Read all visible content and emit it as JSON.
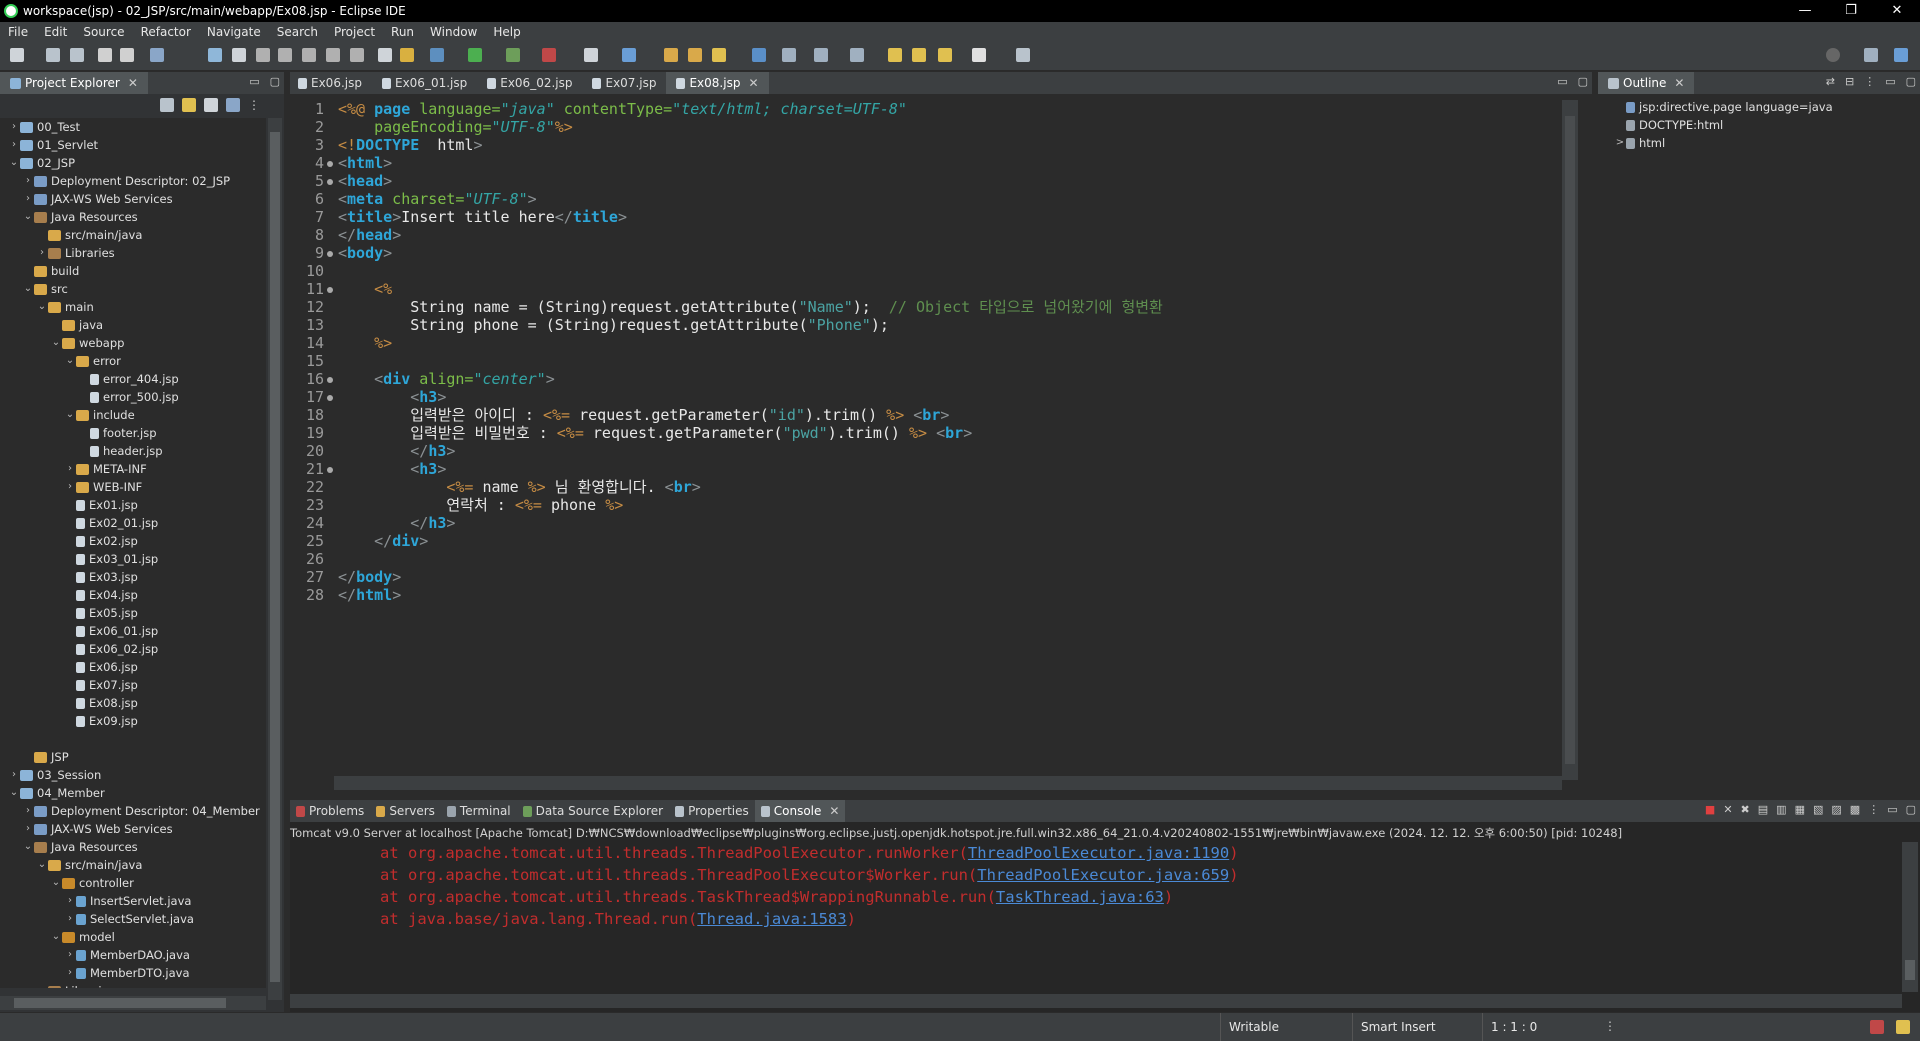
{
  "window": {
    "title": "workspace(jsp) - 02_JSP/src/main/webapp/Ex08.jsp - Eclipse IDE",
    "controls": [
      "—",
      "❐",
      "✕"
    ]
  },
  "menu": [
    "File",
    "Edit",
    "Source",
    "Refactor",
    "Navigate",
    "Search",
    "Project",
    "Run",
    "Window",
    "Help"
  ],
  "project_explorer": {
    "title": "Project Explorer",
    "items": [
      {
        "label": "00_Test",
        "indent": 0,
        "arrow": ">",
        "icon": "proj"
      },
      {
        "label": "01_Servlet",
        "indent": 0,
        "arrow": ">",
        "icon": "proj"
      },
      {
        "label": "02_JSP",
        "indent": 0,
        "arrow": "v",
        "icon": "proj"
      },
      {
        "label": "Deployment Descriptor: 02_JSP",
        "indent": 1,
        "arrow": ">",
        "icon": "svc"
      },
      {
        "label": "JAX-WS Web Services",
        "indent": 1,
        "arrow": ">",
        "icon": "svc"
      },
      {
        "label": "Java Resources",
        "indent": 1,
        "arrow": "v",
        "icon": "lib"
      },
      {
        "label": "src/main/java",
        "indent": 2,
        "arrow": "",
        "icon": "folder"
      },
      {
        "label": "Libraries",
        "indent": 2,
        "arrow": ">",
        "icon": "lib"
      },
      {
        "label": "build",
        "indent": 1,
        "arrow": "",
        "icon": "folder"
      },
      {
        "label": "src",
        "indent": 1,
        "arrow": "v",
        "icon": "folder"
      },
      {
        "label": "main",
        "indent": 2,
        "arrow": "v",
        "icon": "folder"
      },
      {
        "label": "java",
        "indent": 3,
        "arrow": "",
        "icon": "folder"
      },
      {
        "label": "webapp",
        "indent": 3,
        "arrow": "v",
        "icon": "folder"
      },
      {
        "label": "error",
        "indent": 4,
        "arrow": "v",
        "icon": "folder"
      },
      {
        "label": "error_404.jsp",
        "indent": 5,
        "arrow": "",
        "icon": "file"
      },
      {
        "label": "error_500.jsp",
        "indent": 5,
        "arrow": "",
        "icon": "file"
      },
      {
        "label": "include",
        "indent": 4,
        "arrow": "v",
        "icon": "folder"
      },
      {
        "label": "footer.jsp",
        "indent": 5,
        "arrow": "",
        "icon": "file"
      },
      {
        "label": "header.jsp",
        "indent": 5,
        "arrow": "",
        "icon": "file"
      },
      {
        "label": "META-INF",
        "indent": 4,
        "arrow": ">",
        "icon": "folder"
      },
      {
        "label": "WEB-INF",
        "indent": 4,
        "arrow": ">",
        "icon": "folder"
      },
      {
        "label": "Ex01.jsp",
        "indent": 4,
        "arrow": "",
        "icon": "file"
      },
      {
        "label": "Ex02_01.jsp",
        "indent": 4,
        "arrow": "",
        "icon": "file"
      },
      {
        "label": "Ex02.jsp",
        "indent": 4,
        "arrow": "",
        "icon": "file"
      },
      {
        "label": "Ex03_01.jsp",
        "indent": 4,
        "arrow": "",
        "icon": "file"
      },
      {
        "label": "Ex03.jsp",
        "indent": 4,
        "arrow": "",
        "icon": "file"
      },
      {
        "label": "Ex04.jsp",
        "indent": 4,
        "arrow": "",
        "icon": "file"
      },
      {
        "label": "Ex05.jsp",
        "indent": 4,
        "arrow": "",
        "icon": "file"
      },
      {
        "label": "Ex06_01.jsp",
        "indent": 4,
        "arrow": "",
        "icon": "file"
      },
      {
        "label": "Ex06_02.jsp",
        "indent": 4,
        "arrow": "",
        "icon": "file"
      },
      {
        "label": "Ex06.jsp",
        "indent": 4,
        "arrow": "",
        "icon": "file"
      },
      {
        "label": "Ex07.jsp",
        "indent": 4,
        "arrow": "",
        "icon": "file"
      },
      {
        "label": "Ex08.jsp",
        "indent": 4,
        "arrow": "",
        "icon": "file"
      },
      {
        "label": "Ex09.jsp",
        "indent": 4,
        "arrow": "",
        "icon": "file"
      },
      {
        "label": "",
        "indent": 0,
        "arrow": "",
        "icon": ""
      },
      {
        "label": "JSP",
        "indent": 1,
        "arrow": "",
        "icon": "folder"
      },
      {
        "label": "03_Session",
        "indent": 0,
        "arrow": ">",
        "icon": "proj"
      },
      {
        "label": "04_Member",
        "indent": 0,
        "arrow": "v",
        "icon": "proj"
      },
      {
        "label": "Deployment Descriptor: 04_Member",
        "indent": 1,
        "arrow": ">",
        "icon": "svc"
      },
      {
        "label": "JAX-WS Web Services",
        "indent": 1,
        "arrow": ">",
        "icon": "svc"
      },
      {
        "label": "Java Resources",
        "indent": 1,
        "arrow": "v",
        "icon": "lib"
      },
      {
        "label": "src/main/java",
        "indent": 2,
        "arrow": "v",
        "icon": "folder"
      },
      {
        "label": "controller",
        "indent": 3,
        "arrow": "v",
        "icon": "pkg"
      },
      {
        "label": "InsertServlet.java",
        "indent": 4,
        "arrow": ">",
        "icon": "java"
      },
      {
        "label": "SelectServlet.java",
        "indent": 4,
        "arrow": ">",
        "icon": "java"
      },
      {
        "label": "model",
        "indent": 3,
        "arrow": "v",
        "icon": "pkg"
      },
      {
        "label": "MemberDAO.java",
        "indent": 4,
        "arrow": ">",
        "icon": "java"
      },
      {
        "label": "MemberDTO.java",
        "indent": 4,
        "arrow": ">",
        "icon": "java"
      },
      {
        "label": "Libraries",
        "indent": 2,
        "arrow": ">",
        "icon": "lib"
      },
      {
        "label": "build",
        "indent": 1,
        "arrow": ">",
        "icon": "folder"
      }
    ]
  },
  "editor_tabs": [
    {
      "label": "Ex06.jsp",
      "active": false
    },
    {
      "label": "Ex06_01.jsp",
      "active": false
    },
    {
      "label": "Ex06_02.jsp",
      "active": false
    },
    {
      "label": "Ex07.jsp",
      "active": false
    },
    {
      "label": "Ex08.jsp",
      "active": true
    }
  ],
  "editor": {
    "line_numbers": [
      "1",
      "2",
      "3",
      "4",
      "5",
      "6",
      "7",
      "8",
      "9",
      "10",
      "11",
      "12",
      "13",
      "14",
      "15",
      "16",
      "17",
      "18",
      "19",
      "20",
      "21",
      "22",
      "23",
      "24",
      "25",
      "26",
      "27",
      "28"
    ],
    "fold_markers": [
      4,
      5,
      9,
      11,
      16,
      17,
      21
    ],
    "lines": [
      [
        [
          "scr",
          "<%@ "
        ],
        [
          "kw",
          "page"
        ],
        [
          "attr",
          " language="
        ],
        [
          "val",
          "\"java\""
        ],
        [
          "attr",
          " contentType="
        ],
        [
          "val",
          "\"text/html; charset=UTF-8\""
        ]
      ],
      [
        [
          "",
          "    "
        ],
        [
          "attr",
          "pageEncoding="
        ],
        [
          "val",
          "\"UTF-8\""
        ],
        [
          "scr",
          "%>"
        ]
      ],
      [
        [
          "scr",
          "<!"
        ],
        [
          "kw",
          "DOCTYPE"
        ],
        [
          "",
          "  html"
        ],
        [
          "tagb",
          ">"
        ]
      ],
      [
        [
          "tagb",
          "<"
        ],
        [
          "kw",
          "html"
        ],
        [
          "tagb",
          ">"
        ]
      ],
      [
        [
          "tagb",
          "<"
        ],
        [
          "kw",
          "head"
        ],
        [
          "tagb",
          ">"
        ]
      ],
      [
        [
          "tagb",
          "<"
        ],
        [
          "kw",
          "meta"
        ],
        [
          "attr",
          " charset="
        ],
        [
          "val",
          "\"UTF-8\""
        ],
        [
          "tagb",
          ">"
        ]
      ],
      [
        [
          "tagb",
          "<"
        ],
        [
          "kw",
          "title"
        ],
        [
          "tagb",
          ">"
        ],
        [
          "",
          "Insert title here"
        ],
        [
          "tagb",
          "</"
        ],
        [
          "kw",
          "title"
        ],
        [
          "tagb",
          ">"
        ]
      ],
      [
        [
          "tagb",
          "</"
        ],
        [
          "kw",
          "head"
        ],
        [
          "tagb",
          ">"
        ]
      ],
      [
        [
          "tagb",
          "<"
        ],
        [
          "kw",
          "body"
        ],
        [
          "tagb",
          ">"
        ]
      ],
      [
        [
          "",
          ""
        ]
      ],
      [
        [
          "",
          "    "
        ],
        [
          "scr",
          "<%"
        ]
      ],
      [
        [
          "",
          "        String name = (String)request.getAttribute("
        ],
        [
          "str",
          "\"Name\""
        ],
        [
          "",
          ");  "
        ],
        [
          "cmt",
          "// Object 타입으로 넘어왔기에 형변환"
        ]
      ],
      [
        [
          "",
          "        String phone = (String)request.getAttribute("
        ],
        [
          "str",
          "\"Phone\""
        ],
        [
          "",
          ");"
        ]
      ],
      [
        [
          "",
          "    "
        ],
        [
          "scr",
          "%>"
        ]
      ],
      [
        [
          "",
          ""
        ]
      ],
      [
        [
          "",
          "    "
        ],
        [
          "tagb",
          "<"
        ],
        [
          "kw",
          "div"
        ],
        [
          "attr",
          " align="
        ],
        [
          "val",
          "\"center\""
        ],
        [
          "tagb",
          ">"
        ]
      ],
      [
        [
          "",
          "        "
        ],
        [
          "tagb",
          "<"
        ],
        [
          "kw",
          "h3"
        ],
        [
          "tagb",
          ">"
        ]
      ],
      [
        [
          "",
          "        입력받은 아이디 : "
        ],
        [
          "scr",
          "<%="
        ],
        [
          "",
          " request.getParameter("
        ],
        [
          "str",
          "\"id\""
        ],
        [
          "",
          ").trim() "
        ],
        [
          "scr",
          "%>"
        ],
        [
          "",
          " "
        ],
        [
          "tagb",
          "<"
        ],
        [
          "kw",
          "br"
        ],
        [
          "tagb",
          ">"
        ]
      ],
      [
        [
          "",
          "        입력받은 비밀번호 : "
        ],
        [
          "scr",
          "<%="
        ],
        [
          "",
          " request.getParameter("
        ],
        [
          "str",
          "\"pwd\""
        ],
        [
          "",
          ").trim() "
        ],
        [
          "scr",
          "%>"
        ],
        [
          "",
          " "
        ],
        [
          "tagb",
          "<"
        ],
        [
          "kw",
          "br"
        ],
        [
          "tagb",
          ">"
        ]
      ],
      [
        [
          "",
          "        "
        ],
        [
          "tagb",
          "</"
        ],
        [
          "kw",
          "h3"
        ],
        [
          "tagb",
          ">"
        ]
      ],
      [
        [
          "",
          "        "
        ],
        [
          "tagb",
          "<"
        ],
        [
          "kw",
          "h3"
        ],
        [
          "tagb",
          ">"
        ]
      ],
      [
        [
          "",
          "            "
        ],
        [
          "scr",
          "<%="
        ],
        [
          "",
          " name "
        ],
        [
          "scr",
          "%>"
        ],
        [
          "",
          " 님 환영합니다. "
        ],
        [
          "tagb",
          "<"
        ],
        [
          "kw",
          "br"
        ],
        [
          "tagb",
          ">"
        ]
      ],
      [
        [
          "",
          "            연락처 : "
        ],
        [
          "scr",
          "<%="
        ],
        [
          "",
          " phone "
        ],
        [
          "scr",
          "%>"
        ]
      ],
      [
        [
          "",
          "        "
        ],
        [
          "tagb",
          "</"
        ],
        [
          "kw",
          "h3"
        ],
        [
          "tagb",
          ">"
        ]
      ],
      [
        [
          "",
          "    "
        ],
        [
          "tagb",
          "</"
        ],
        [
          "kw",
          "div"
        ],
        [
          "tagb",
          ">"
        ]
      ],
      [
        [
          "",
          ""
        ]
      ],
      [
        [
          "tagb",
          "</"
        ],
        [
          "kw",
          "body"
        ],
        [
          "tagb",
          ">"
        ]
      ],
      [
        [
          "tagb",
          "</"
        ],
        [
          "kw",
          "html"
        ],
        [
          "tagb",
          ">"
        ]
      ]
    ]
  },
  "outline": {
    "title": "Outline",
    "items": [
      {
        "label": "jsp:directive.page language=java",
        "arrow": ""
      },
      {
        "label": "DOCTYPE:html",
        "arrow": ""
      },
      {
        "label": "html",
        "arrow": ">"
      }
    ]
  },
  "bottom_tabs": [
    {
      "label": "Problems",
      "active": false
    },
    {
      "label": "Servers",
      "active": false
    },
    {
      "label": "Terminal",
      "active": false
    },
    {
      "label": "Data Source Explorer",
      "active": false
    },
    {
      "label": "Properties",
      "active": false
    },
    {
      "label": "Console",
      "active": true
    }
  ],
  "console": {
    "header": "Tomcat v9.0 Server at localhost [Apache Tomcat] D:₩NCS₩download₩eclipse₩plugins₩org.eclipse.justj.openjdk.hotspot.jre.full.win32.x86_64_21.0.4.v20240802-1551₩jre₩bin₩javaw.exe  (2024. 12. 12. 오후 6:00:50) [pid: 10248]",
    "lines": [
      {
        "text": "at org.apache.tomcat.util.threads.ThreadPoolExecutor.runWorker(",
        "link": "ThreadPoolExecutor.java:1190",
        "end": ")"
      },
      {
        "text": "at org.apache.tomcat.util.threads.ThreadPoolExecutor$Worker.run(",
        "link": "ThreadPoolExecutor.java:659",
        "end": ")"
      },
      {
        "text": "at org.apache.tomcat.util.threads.TaskThread$WrappingRunnable.run(",
        "link": "TaskThread.java:63",
        "end": ")"
      },
      {
        "text": "at java.base/java.lang.Thread.run(",
        "link": "Thread.java:1583",
        "end": ")"
      }
    ]
  },
  "status": {
    "mode": "Writable",
    "insert": "Smart Insert",
    "position": "1 : 1 : 0"
  },
  "colors": {
    "accent_active_tab": "#515658",
    "error_text": "#c22d2d",
    "link": "#4b8ad6",
    "keyword": "#2ea6d8"
  }
}
